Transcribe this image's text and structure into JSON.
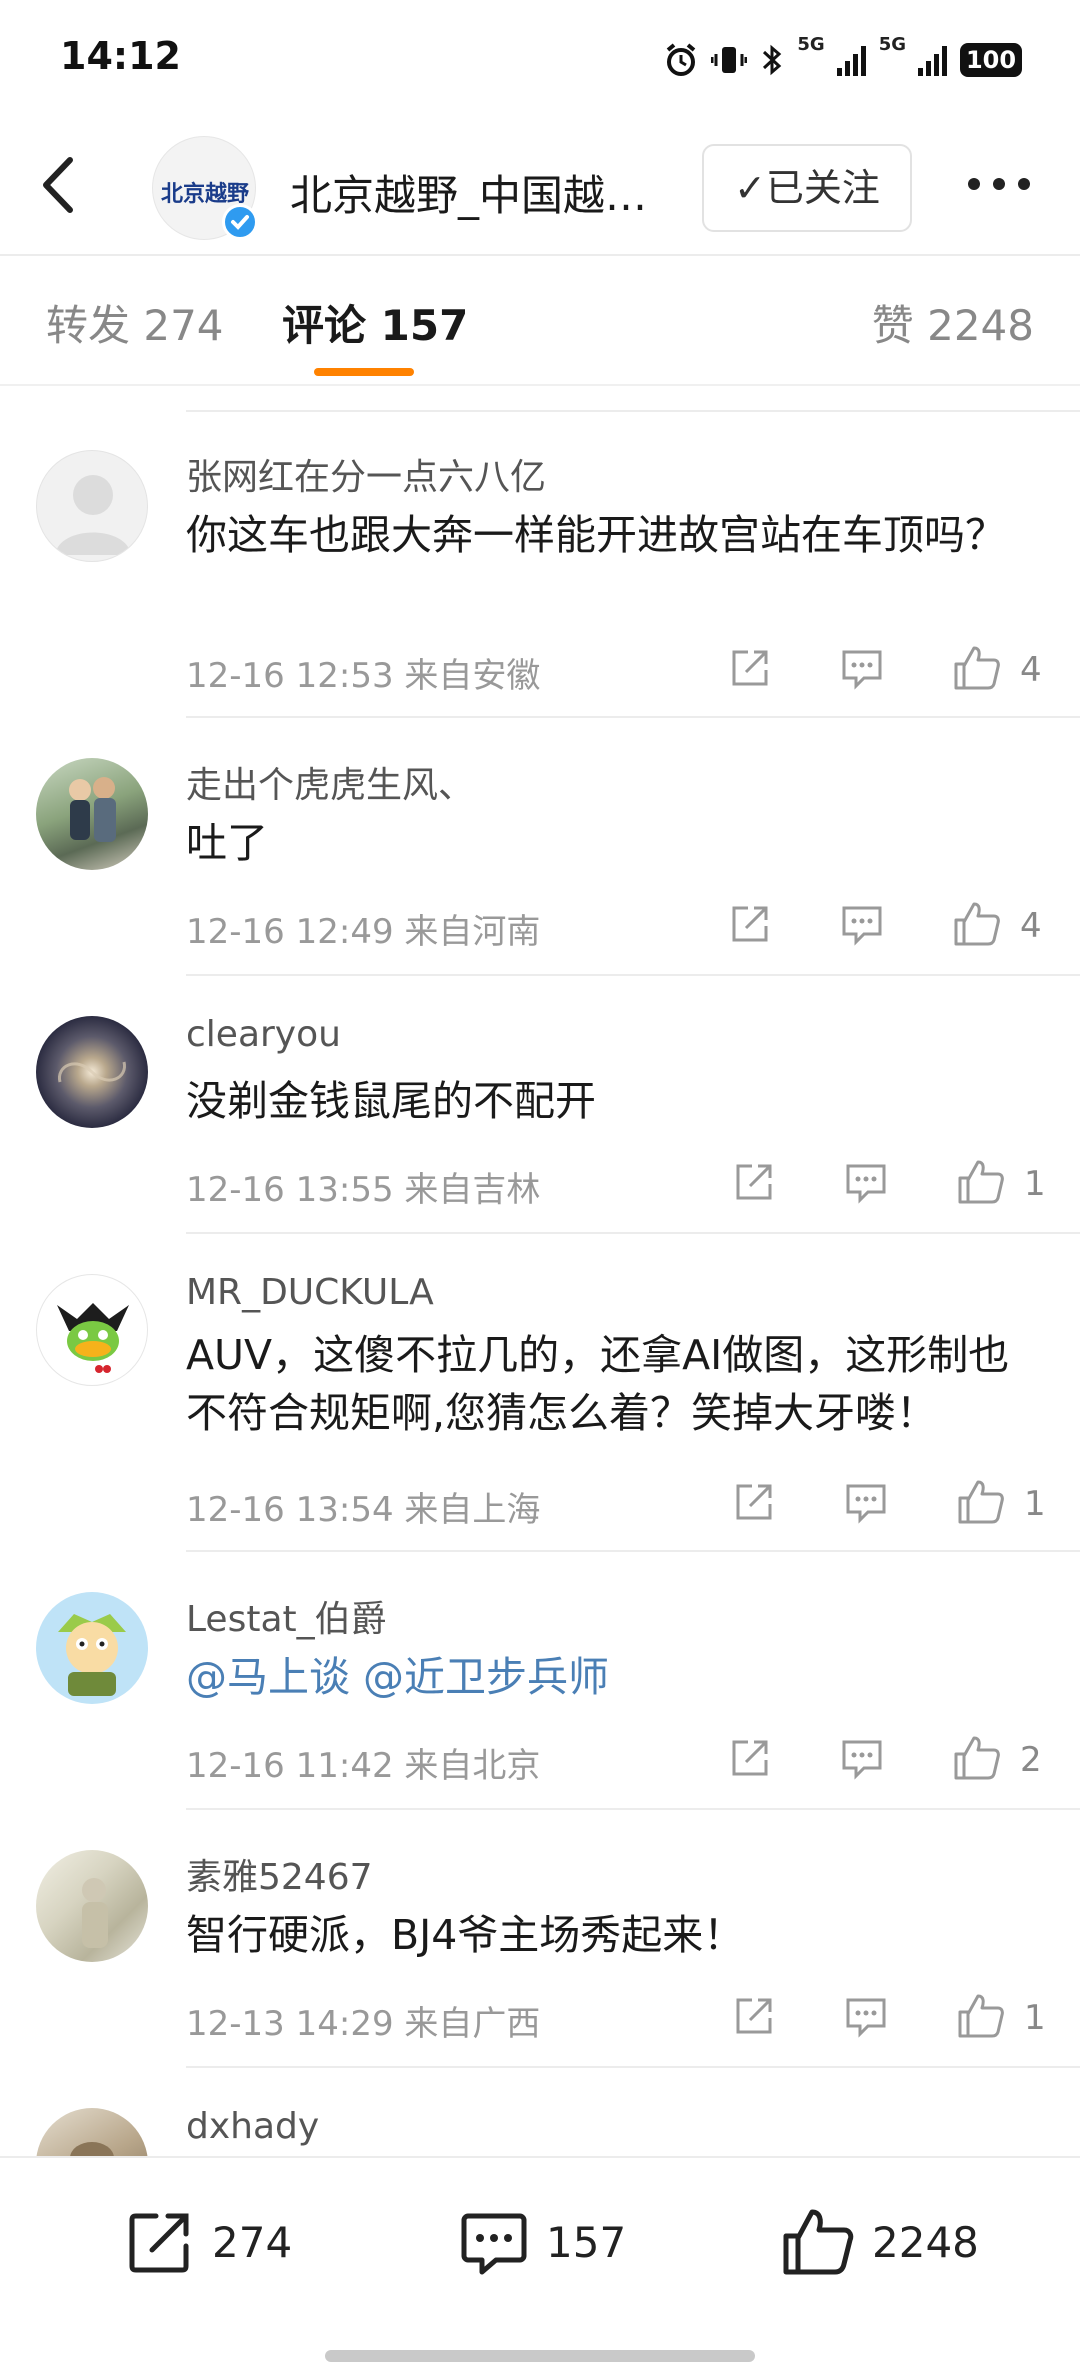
{
  "status_bar": {
    "time": "14:12",
    "battery": "100",
    "network_1": "5G",
    "network_2": "5G"
  },
  "header": {
    "profile_name": "北京越野_中国越…",
    "avatar_text": "北京越野",
    "follow_label": "✓已关注"
  },
  "tabs": [
    {
      "label": "转发 274"
    },
    {
      "label": "评论 157"
    },
    {
      "label": "赞 2248"
    }
  ],
  "comments": [
    {
      "user": "张网红在分一点六八亿",
      "text": "你这车也跟大奔一样能开进故宫站在车顶吗？",
      "time": "12-16 12:53",
      "location": "来自安徽",
      "likes": "4",
      "avatar": "default-avatar"
    },
    {
      "user": "走出个虎虎生风、",
      "text": "吐了",
      "time": "12-16 12:49",
      "location": "来自河南",
      "likes": "4",
      "avatar": "couple-photo"
    },
    {
      "user": "clearyou",
      "text": "没剃金钱鼠尾的不配开",
      "time": "12-16 13:55",
      "location": "来自吉林",
      "likes": "1",
      "avatar": "galaxy-photo"
    },
    {
      "user": "MR_DUCKULA",
      "text": "AUV，这傻不拉几的，还拿AI做图，这形制也不符合规矩啊,您猜怎么着？笑掉大牙喽！",
      "time": "12-16 13:54",
      "location": "来自上海",
      "likes": "1",
      "avatar": "duck-cartoon"
    },
    {
      "user": "Lestat_伯爵",
      "text": "@马上谈 @近卫步兵师",
      "time": "12-16 11:42",
      "location": "来自北京",
      "likes": "2",
      "avatar": "cartoon-character"
    },
    {
      "user": "素雅52467",
      "text": "智行硬派，BJ4爷主场秀起来！",
      "time": "12-13 14:29",
      "location": "来自广西",
      "likes": "1",
      "avatar": "faded-photo"
    },
    {
      "user": "dxhady",
      "text": "",
      "time": "",
      "location": "",
      "likes": "",
      "avatar": "dog-photo"
    }
  ],
  "bottom_bar": {
    "reposts": "274",
    "comments": "157",
    "likes": "2248"
  },
  "colors": {
    "accent": "#ff8200",
    "link": "#4a7fb5",
    "verified": "#2f9bf0"
  }
}
